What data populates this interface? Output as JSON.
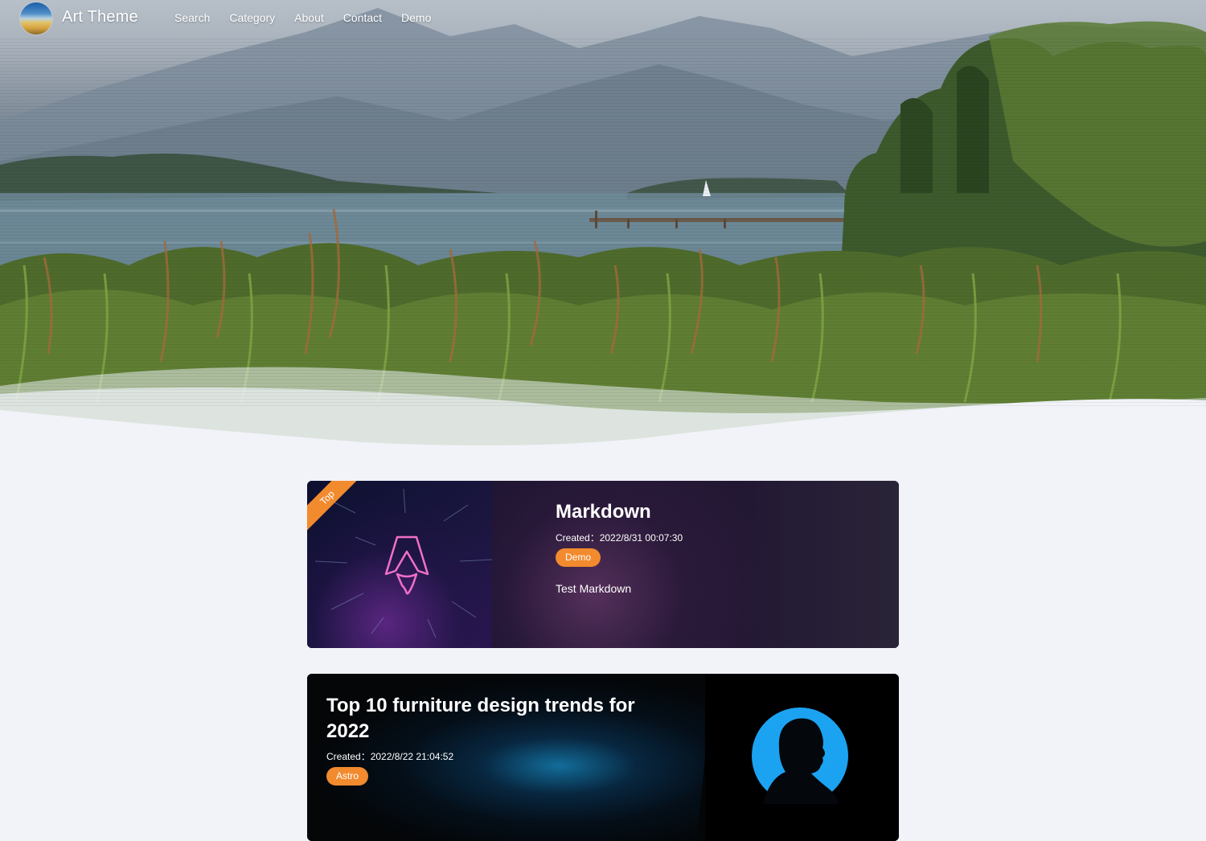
{
  "site": {
    "title": "Art Theme"
  },
  "nav": {
    "links": [
      "Search",
      "Category",
      "About",
      "Contact",
      "Demo"
    ]
  },
  "posts": [
    {
      "ribbon": "Top",
      "title": "Markdown",
      "created": "Created：2022/8/31 00:07:30",
      "tag": "Demo",
      "excerpt": "Test Markdown"
    },
    {
      "title": "Top 10 furniture design trends for 2022",
      "created": "Created：2022/8/22 21:04:52",
      "tag": "Astro"
    }
  ],
  "colors": {
    "accent": "#f28a2e",
    "page_bg": "#f1f3f8",
    "neon": "#f070c8",
    "avatar_blue": "#1ba3f2"
  },
  "icons": [
    "astro-rocket-icon",
    "silhouette-avatar-icon"
  ]
}
